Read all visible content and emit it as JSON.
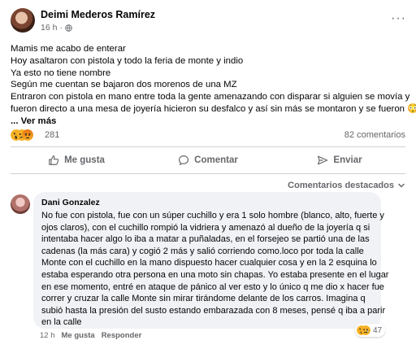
{
  "post": {
    "author": "Deimi Mederos Ramírez",
    "time": "16 h",
    "separator": "·",
    "more_label": "···",
    "body_lines": [
      "Mamis me acabo de enterar",
      "Hoy asaltaron con pistola y todo la feria de monte y indio",
      "Ya esto no tiene nombre",
      "Según me cuentan se bajaron dos morenos  de una MZ",
      "Entraron con pistola en mano entre toda la gente amenazando con disparar si alguien se movía y",
      "fueron directo a una mesa de joyería hicieron su desfalco y así sin más se montaron y se fueron 😳"
    ],
    "see_more": "... Ver más"
  },
  "reactions": {
    "count": "281",
    "comments": "82 comentarios",
    "icons": [
      "wow",
      "sad",
      "angry"
    ]
  },
  "actions": {
    "like": "Me gusta",
    "comment": "Comentar",
    "share": "Enviar"
  },
  "sort_label": "Comentarios destacados",
  "comment": {
    "author": "Dani Gonzalez",
    "lines": [
      "No fue con pistola, fue con un súper cuchillo y era 1 solo hombre (blanco, alto, fuerte y",
      "ojos claros), con el cuchillo rompió la vidriera y amenazó al dueño de la joyería q si",
      "intentaba hacer algo lo iba a matar a puñaladas, en el forsejeo se partió una de las",
      "cadenas (la más cara) y cogió 2 más y salió corriendo como.loco por toda la calle",
      "Monte con el cuchillo en la mano dispuesto hacer cualquier cosa y en la 2 esquina lo",
      "estaba esperando otra persona en una moto sin chapas. Yo estaba presente en el lugar",
      "en ese momento, entré en ataque de pánico al ver esto y lo único q me dio x hacer fue",
      "correr y cruzar la calle Monte sin mirar tirándome delante de los carros. Imagina q",
      "subió hasta la presión del susto estando embarazada con 8 meses, pensé q iba a parir",
      "en la calle"
    ],
    "time": "12 h",
    "like": "Me gusta",
    "reply": "Responder",
    "reaction_count": "47",
    "reaction_icons": [
      "wow",
      "sad"
    ]
  },
  "colors": {
    "meta": "#65676b",
    "divider": "#ced0d4",
    "bubble": "#f0f2f5",
    "react_yellow": "#f7b125"
  }
}
